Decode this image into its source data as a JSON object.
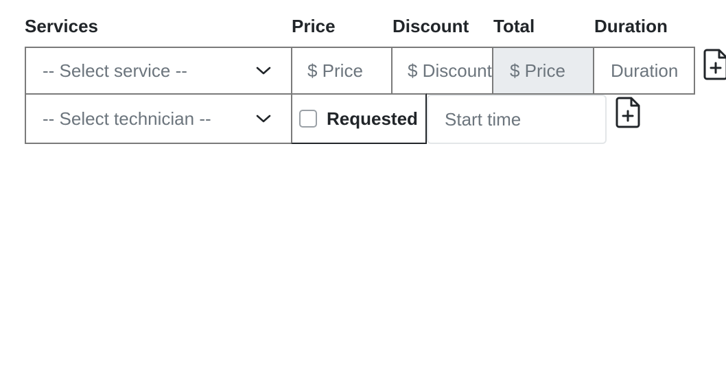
{
  "headers": {
    "services": "Services",
    "price": "Price",
    "discount": "Discount",
    "total": "Total",
    "duration": "Duration"
  },
  "row1": {
    "service_select": "-- Select service --",
    "price_placeholder": "$ Price",
    "discount_placeholder": "$ Discount",
    "total_placeholder": "$ Price",
    "duration_placeholder": "Duration"
  },
  "row2": {
    "technician_select": "-- Select technician --",
    "requested_label": "Requested",
    "requested_checked": false,
    "start_time_placeholder": "Start time"
  },
  "icons": {
    "add_row_1": "file-plus-icon",
    "add_row_2": "file-plus-icon",
    "select_arrow": "chevron-down-icon"
  }
}
